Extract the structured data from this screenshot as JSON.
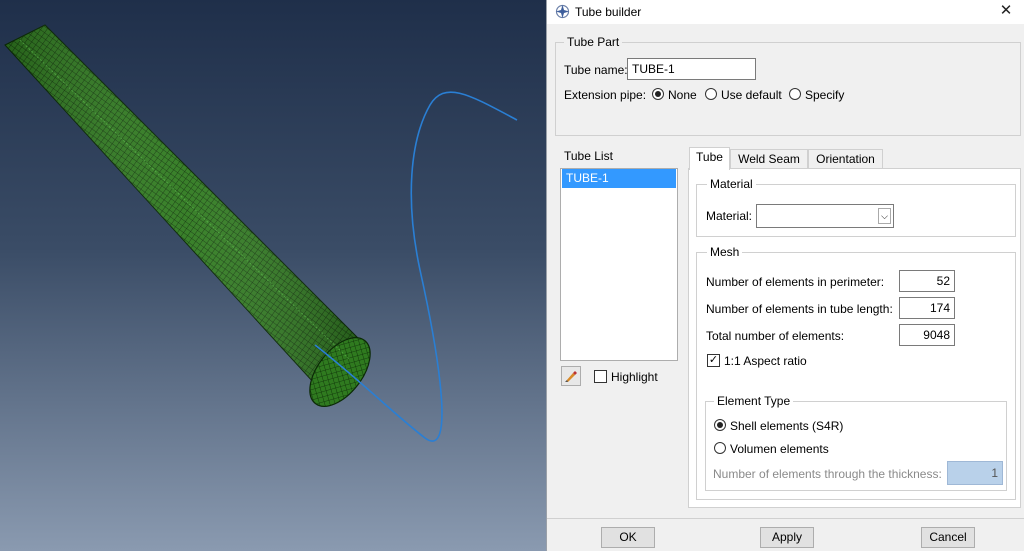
{
  "dialog": {
    "title": "Tube builder",
    "close_glyph": "✕",
    "app_icon": "abaqus-compass-icon"
  },
  "tube_part": {
    "legend": "Tube Part",
    "name_label": "Tube name:",
    "name_value": "TUBE-1",
    "extension_label": "Extension pipe:",
    "extension_options": [
      {
        "label": "None",
        "selected": true
      },
      {
        "label": "Use default",
        "selected": false
      },
      {
        "label": "Specify",
        "selected": false
      }
    ]
  },
  "tube_list": {
    "legend": "Tube List",
    "items": [
      "TUBE-1"
    ],
    "highlight_label": "Highlight",
    "highlight_checked": false
  },
  "tabs": [
    {
      "label": "Tube",
      "active": true
    },
    {
      "label": "Weld Seam",
      "active": false
    },
    {
      "label": "Orientation",
      "active": false
    }
  ],
  "material": {
    "legend": "Material",
    "label": "Material:",
    "value": ""
  },
  "mesh": {
    "legend": "Mesh",
    "perimeter_label": "Number of elements in perimeter:",
    "perimeter_value": "52",
    "length_label": "Number of elements in tube length:",
    "length_value": "174",
    "total_label": "Total number of elements:",
    "total_value": "9048",
    "aspect_label": "1:1 Aspect ratio",
    "aspect_checked": true
  },
  "element_type": {
    "legend": "Element Type",
    "options": [
      {
        "label": "Shell elements (S4R)",
        "selected": true
      },
      {
        "label": "Volumen elements",
        "selected": false
      }
    ],
    "thickness_label": "Number of elements through the thickness:",
    "thickness_value": "1"
  },
  "buttons": {
    "ok": "OK",
    "apply": "Apply",
    "cancel": "Cancel"
  },
  "colors": {
    "tube_green": "#2f7a1f",
    "path_blue": "#2a7fd4",
    "selection": "#3399ff"
  }
}
